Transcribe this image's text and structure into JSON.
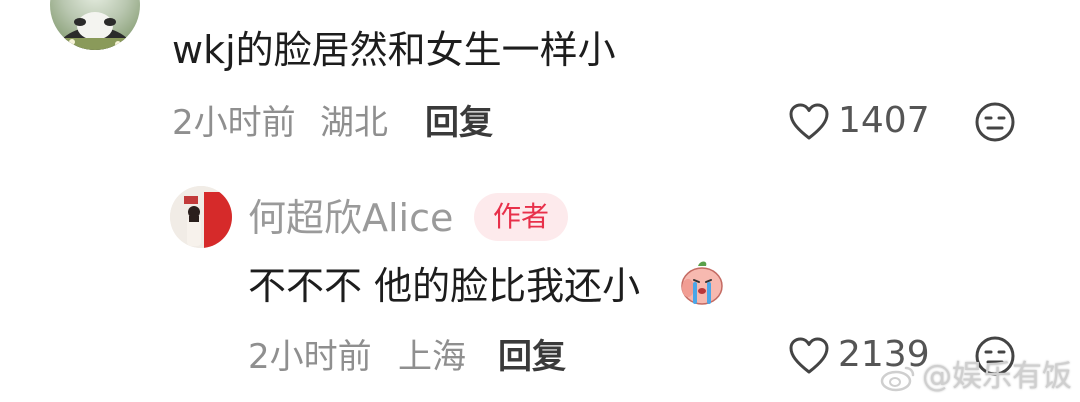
{
  "comment": {
    "text": "wkj的脸居然和女生一样小",
    "time": "2小时前",
    "location": "湖北",
    "reply_label": "回复",
    "likes": "1407"
  },
  "reply": {
    "username": "何超欣Alice",
    "author_badge": "作者",
    "text": "不不不 他的脸比我还小",
    "time": "2小时前",
    "location": "上海",
    "reply_label": "回复",
    "likes": "2139"
  },
  "watermark": {
    "text": "@娱乐有饭"
  },
  "icons": {
    "like": "heart-outline-icon",
    "dislike": "neutral-face-icon",
    "sticker": "crying-peach-sticker",
    "weibo": "weibo-logo"
  },
  "colors": {
    "badge_text": "#e8304a",
    "badge_bg": "#fdeaec",
    "meta_gray": "#8f8f8f"
  }
}
